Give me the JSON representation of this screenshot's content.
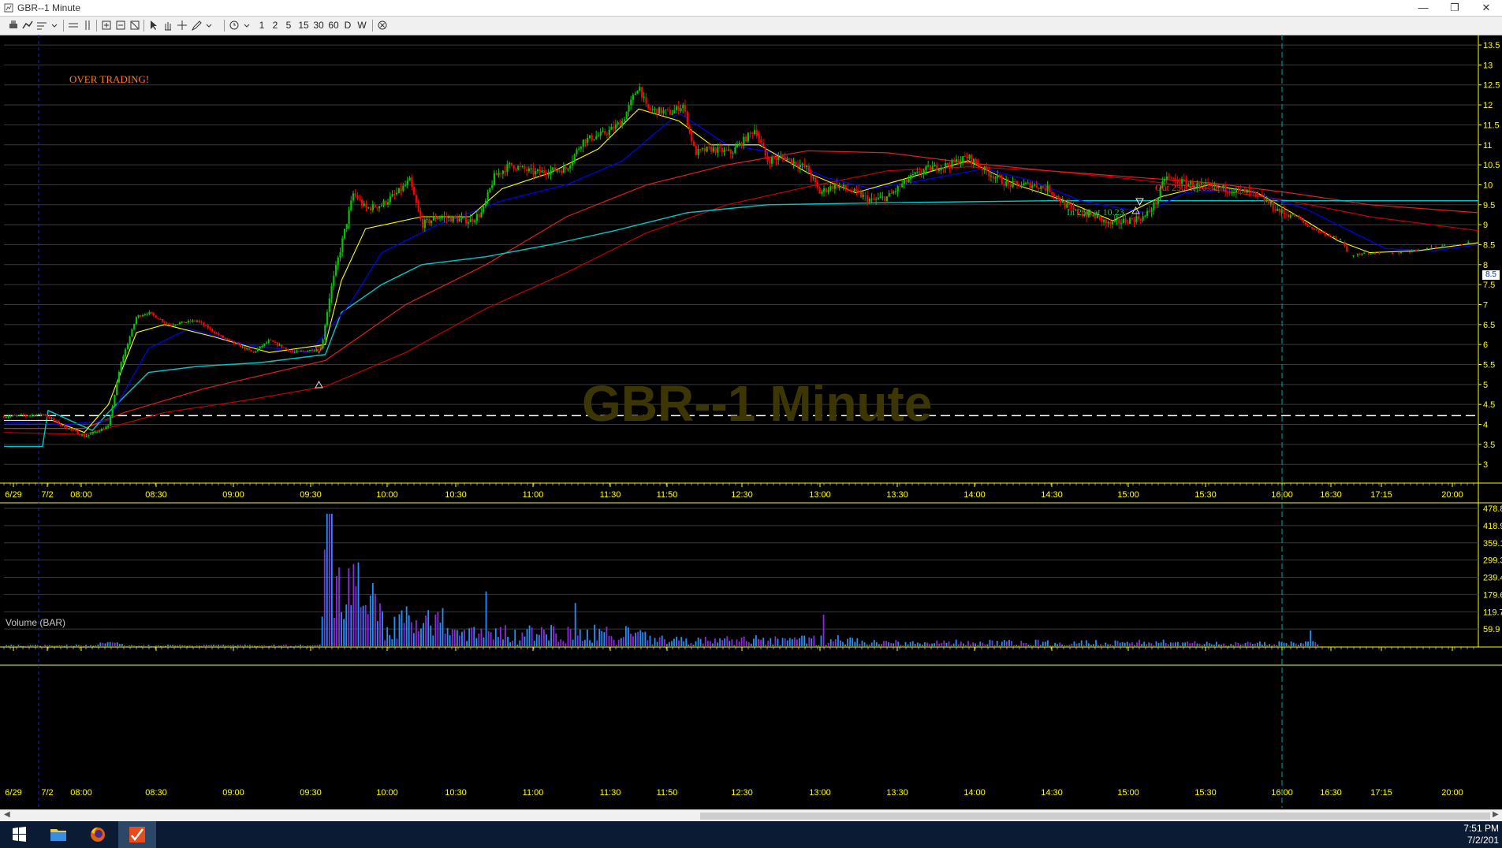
{
  "window": {
    "title": "GBR--1 Minute",
    "controls": {
      "minimize": "—",
      "maximize": "❐",
      "close": "✕"
    }
  },
  "toolbar": {
    "intervals": [
      "1",
      "2",
      "5",
      "15",
      "30",
      "60",
      "D",
      "W"
    ]
  },
  "chart": {
    "watermark": "GBR--1 Minute",
    "annotation": "OVER TRADING!",
    "trades": {
      "in": "In 250 at 10.23",
      "out": "Out 250 at 10.32"
    },
    "price_tag": "8.5",
    "volume_label": "Volume (BAR)",
    "colors": {
      "up": "#00c800",
      "down": "#ff0000",
      "ema_fast": "#ffff00",
      "ema_mid": "#0000ff",
      "vwap": "#00c8c8",
      "ma_slow": "#c80000"
    }
  },
  "chart_data": {
    "type": "candlestick",
    "x_ticks": [
      "6/29",
      "7/2",
      "08:00",
      "08:30",
      "09:00",
      "09:30",
      "10:00",
      "10:30",
      "11:00",
      "11:30",
      "11:50",
      "12:30",
      "13:00",
      "13:30",
      "14:00",
      "14:30",
      "15:00",
      "15:30",
      "16:00",
      "16:30",
      "17:15",
      "20:00"
    ],
    "y_ticks": [
      "13.5",
      "13",
      "12.5",
      "12",
      "11.5",
      "11",
      "10.5",
      "10",
      "9.5",
      "9",
      "8.5",
      "8",
      "7.5",
      "7",
      "6.5",
      "6",
      "5.5",
      "5",
      "4.5",
      "4",
      "3.5",
      "3"
    ],
    "ylim": [
      2.55,
      13.6
    ],
    "reference_line": 4.22,
    "volume_y_ticks": [
      "478.8",
      "418.9",
      "359.1",
      "299.3",
      "239.4",
      "179.6",
      "119.7",
      "59.9"
    ],
    "volume_ylim": [
      0,
      478.8
    ],
    "close_path": [
      [
        0,
        4.2
      ],
      [
        50,
        4.25
      ],
      [
        70,
        4.0
      ],
      [
        100,
        3.7
      ],
      [
        130,
        3.95
      ],
      [
        145,
        5.5
      ],
      [
        165,
        6.7
      ],
      [
        180,
        6.8
      ],
      [
        205,
        6.5
      ],
      [
        240,
        6.6
      ],
      [
        270,
        6.2
      ],
      [
        310,
        5.8
      ],
      [
        330,
        6.1
      ],
      [
        360,
        5.8
      ],
      [
        395,
        5.9
      ],
      [
        405,
        7.2
      ],
      [
        420,
        8.5
      ],
      [
        435,
        9.8
      ],
      [
        450,
        9.4
      ],
      [
        470,
        9.5
      ],
      [
        490,
        9.8
      ],
      [
        505,
        10.1
      ],
      [
        520,
        9.0
      ],
      [
        540,
        9.2
      ],
      [
        580,
        9.1
      ],
      [
        595,
        9.3
      ],
      [
        610,
        10.2
      ],
      [
        630,
        10.5
      ],
      [
        660,
        10.3
      ],
      [
        700,
        10.4
      ],
      [
        720,
        11.1
      ],
      [
        750,
        11.3
      ],
      [
        770,
        11.6
      ],
      [
        790,
        12.5
      ],
      [
        800,
        11.9
      ],
      [
        830,
        11.8
      ],
      [
        845,
        12.0
      ],
      [
        860,
        10.8
      ],
      [
        880,
        10.9
      ],
      [
        905,
        10.8
      ],
      [
        920,
        11.1
      ],
      [
        935,
        11.4
      ],
      [
        950,
        10.6
      ],
      [
        970,
        10.7
      ],
      [
        1000,
        10.4
      ],
      [
        1015,
        9.8
      ],
      [
        1035,
        10.0
      ],
      [
        1060,
        9.8
      ],
      [
        1080,
        9.6
      ],
      [
        1100,
        9.7
      ],
      [
        1130,
        10.2
      ],
      [
        1150,
        10.4
      ],
      [
        1175,
        10.5
      ],
      [
        1200,
        10.7
      ],
      [
        1225,
        10.3
      ],
      [
        1250,
        10.0
      ],
      [
        1280,
        10.0
      ],
      [
        1300,
        9.9
      ],
      [
        1320,
        9.5
      ],
      [
        1335,
        9.3
      ],
      [
        1360,
        9.2
      ],
      [
        1375,
        9.0
      ],
      [
        1395,
        9.1
      ],
      [
        1420,
        9.2
      ],
      [
        1435,
        9.6
      ],
      [
        1445,
        10.2
      ],
      [
        1460,
        10.1
      ],
      [
        1480,
        10.0
      ],
      [
        1520,
        9.9
      ],
      [
        1550,
        9.8
      ],
      [
        1570,
        9.6
      ],
      [
        1590,
        9.3
      ],
      [
        1610,
        9.2
      ],
      [
        1620,
        9.0
      ],
      [
        1640,
        8.8
      ],
      [
        1665,
        8.6
      ],
      [
        1675,
        8.2
      ],
      [
        1700,
        8.3
      ],
      [
        1740,
        8.3
      ],
      [
        1780,
        8.45
      ],
      [
        1810,
        8.5
      ],
      [
        1835,
        8.6
      ]
    ],
    "ema_fast_path": [
      [
        0,
        4.1
      ],
      [
        60,
        4.1
      ],
      [
        100,
        3.8
      ],
      [
        130,
        4.5
      ],
      [
        165,
        6.3
      ],
      [
        200,
        6.5
      ],
      [
        260,
        6.2
      ],
      [
        330,
        5.8
      ],
      [
        400,
        6.0
      ],
      [
        420,
        7.6
      ],
      [
        450,
        8.9
      ],
      [
        520,
        9.2
      ],
      [
        580,
        9.2
      ],
      [
        620,
        9.9
      ],
      [
        680,
        10.3
      ],
      [
        740,
        10.9
      ],
      [
        790,
        11.9
      ],
      [
        840,
        11.6
      ],
      [
        880,
        11.0
      ],
      [
        940,
        11.0
      ],
      [
        1000,
        10.3
      ],
      [
        1060,
        9.8
      ],
      [
        1130,
        10.2
      ],
      [
        1200,
        10.6
      ],
      [
        1260,
        10.0
      ],
      [
        1320,
        9.6
      ],
      [
        1380,
        9.1
      ],
      [
        1440,
        9.7
      ],
      [
        1500,
        10.0
      ],
      [
        1560,
        9.8
      ],
      [
        1620,
        9.1
      ],
      [
        1660,
        8.6
      ],
      [
        1700,
        8.3
      ],
      [
        1760,
        8.35
      ],
      [
        1835,
        8.55
      ]
    ],
    "ema_mid_path": [
      [
        0,
        4.05
      ],
      [
        80,
        4.0
      ],
      [
        130,
        4.1
      ],
      [
        180,
        5.9
      ],
      [
        230,
        6.4
      ],
      [
        300,
        6.0
      ],
      [
        380,
        5.8
      ],
      [
        430,
        7.0
      ],
      [
        470,
        8.3
      ],
      [
        540,
        9.0
      ],
      [
        620,
        9.6
      ],
      [
        700,
        10.0
      ],
      [
        770,
        10.6
      ],
      [
        840,
        11.8
      ],
      [
        900,
        11.0
      ],
      [
        960,
        10.8
      ],
      [
        1020,
        10.2
      ],
      [
        1080,
        9.9
      ],
      [
        1140,
        10.1
      ],
      [
        1220,
        10.4
      ],
      [
        1280,
        10.1
      ],
      [
        1340,
        9.6
      ],
      [
        1420,
        9.3
      ],
      [
        1470,
        9.8
      ],
      [
        1540,
        9.9
      ],
      [
        1620,
        9.4
      ],
      [
        1680,
        8.8
      ],
      [
        1720,
        8.4
      ],
      [
        1780,
        8.35
      ],
      [
        1835,
        8.5
      ]
    ],
    "vwap_path": [
      [
        0,
        3.45
      ],
      [
        48,
        3.45
      ],
      [
        55,
        4.35
      ],
      [
        110,
        3.85
      ],
      [
        130,
        4.3
      ],
      [
        180,
        5.3
      ],
      [
        240,
        5.45
      ],
      [
        320,
        5.55
      ],
      [
        400,
        5.75
      ],
      [
        420,
        6.8
      ],
      [
        470,
        7.5
      ],
      [
        520,
        8.0
      ],
      [
        600,
        8.2
      ],
      [
        680,
        8.5
      ],
      [
        760,
        8.85
      ],
      [
        850,
        9.3
      ],
      [
        950,
        9.5
      ],
      [
        1100,
        9.55
      ],
      [
        1300,
        9.6
      ],
      [
        1500,
        9.6
      ],
      [
        1620,
        9.6
      ],
      [
        1835,
        9.6
      ]
    ],
    "ma_slow1_path": [
      [
        0,
        3.9
      ],
      [
        100,
        3.9
      ],
      [
        150,
        4.3
      ],
      [
        250,
        4.9
      ],
      [
        400,
        5.6
      ],
      [
        500,
        7.0
      ],
      [
        600,
        8.0
      ],
      [
        700,
        9.2
      ],
      [
        800,
        10.0
      ],
      [
        900,
        10.5
      ],
      [
        1000,
        10.85
      ],
      [
        1100,
        10.8
      ],
      [
        1200,
        10.55
      ],
      [
        1300,
        10.35
      ],
      [
        1400,
        10.2
      ],
      [
        1500,
        10.05
      ],
      [
        1600,
        9.8
      ],
      [
        1700,
        9.5
      ],
      [
        1835,
        9.3
      ]
    ],
    "ma_slow2_path": [
      [
        0,
        3.8
      ],
      [
        100,
        3.75
      ],
      [
        200,
        4.3
      ],
      [
        300,
        4.6
      ],
      [
        400,
        4.95
      ],
      [
        500,
        5.8
      ],
      [
        600,
        6.9
      ],
      [
        700,
        7.8
      ],
      [
        800,
        8.8
      ],
      [
        900,
        9.5
      ],
      [
        1000,
        9.95
      ],
      [
        1100,
        10.35
      ],
      [
        1200,
        10.45
      ],
      [
        1300,
        10.35
      ],
      [
        1400,
        10.15
      ],
      [
        1500,
        9.9
      ],
      [
        1600,
        9.6
      ],
      [
        1700,
        9.2
      ],
      [
        1835,
        8.85
      ]
    ]
  }
}
